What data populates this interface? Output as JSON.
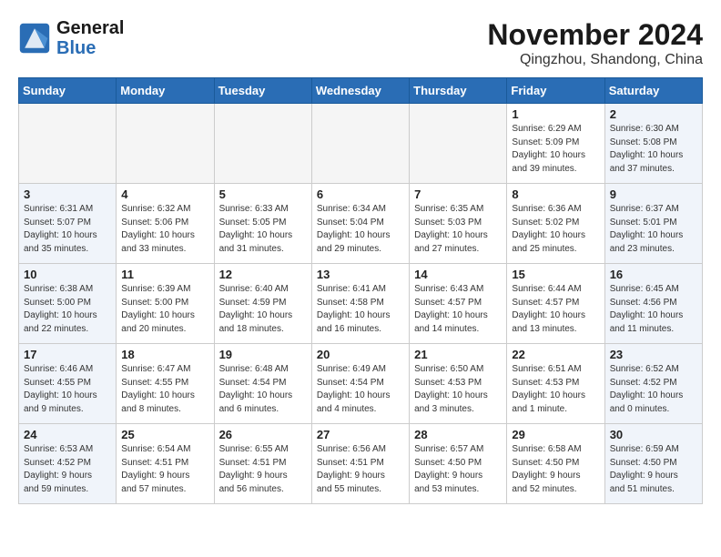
{
  "logo": {
    "line1": "General",
    "line2": "Blue"
  },
  "title": "November 2024",
  "location": "Qingzhou, Shandong, China",
  "weekdays": [
    "Sunday",
    "Monday",
    "Tuesday",
    "Wednesday",
    "Thursday",
    "Friday",
    "Saturday"
  ],
  "weeks": [
    [
      {
        "day": "",
        "info": "",
        "type": "empty"
      },
      {
        "day": "",
        "info": "",
        "type": "empty"
      },
      {
        "day": "",
        "info": "",
        "type": "empty"
      },
      {
        "day": "",
        "info": "",
        "type": "empty"
      },
      {
        "day": "",
        "info": "",
        "type": "empty"
      },
      {
        "day": "1",
        "info": "Sunrise: 6:29 AM\nSunset: 5:09 PM\nDaylight: 10 hours\nand 39 minutes.",
        "type": "weekend"
      },
      {
        "day": "2",
        "info": "Sunrise: 6:30 AM\nSunset: 5:08 PM\nDaylight: 10 hours\nand 37 minutes.",
        "type": "weekend"
      }
    ],
    [
      {
        "day": "3",
        "info": "Sunrise: 6:31 AM\nSunset: 5:07 PM\nDaylight: 10 hours\nand 35 minutes.",
        "type": "weekend"
      },
      {
        "day": "4",
        "info": "Sunrise: 6:32 AM\nSunset: 5:06 PM\nDaylight: 10 hours\nand 33 minutes.",
        "type": "normal"
      },
      {
        "day": "5",
        "info": "Sunrise: 6:33 AM\nSunset: 5:05 PM\nDaylight: 10 hours\nand 31 minutes.",
        "type": "normal"
      },
      {
        "day": "6",
        "info": "Sunrise: 6:34 AM\nSunset: 5:04 PM\nDaylight: 10 hours\nand 29 minutes.",
        "type": "normal"
      },
      {
        "day": "7",
        "info": "Sunrise: 6:35 AM\nSunset: 5:03 PM\nDaylight: 10 hours\nand 27 minutes.",
        "type": "normal"
      },
      {
        "day": "8",
        "info": "Sunrise: 6:36 AM\nSunset: 5:02 PM\nDaylight: 10 hours\nand 25 minutes.",
        "type": "weekend"
      },
      {
        "day": "9",
        "info": "Sunrise: 6:37 AM\nSunset: 5:01 PM\nDaylight: 10 hours\nand 23 minutes.",
        "type": "weekend"
      }
    ],
    [
      {
        "day": "10",
        "info": "Sunrise: 6:38 AM\nSunset: 5:00 PM\nDaylight: 10 hours\nand 22 minutes.",
        "type": "weekend"
      },
      {
        "day": "11",
        "info": "Sunrise: 6:39 AM\nSunset: 5:00 PM\nDaylight: 10 hours\nand 20 minutes.",
        "type": "normal"
      },
      {
        "day": "12",
        "info": "Sunrise: 6:40 AM\nSunset: 4:59 PM\nDaylight: 10 hours\nand 18 minutes.",
        "type": "normal"
      },
      {
        "day": "13",
        "info": "Sunrise: 6:41 AM\nSunset: 4:58 PM\nDaylight: 10 hours\nand 16 minutes.",
        "type": "normal"
      },
      {
        "day": "14",
        "info": "Sunrise: 6:43 AM\nSunset: 4:57 PM\nDaylight: 10 hours\nand 14 minutes.",
        "type": "normal"
      },
      {
        "day": "15",
        "info": "Sunrise: 6:44 AM\nSunset: 4:57 PM\nDaylight: 10 hours\nand 13 minutes.",
        "type": "weekend"
      },
      {
        "day": "16",
        "info": "Sunrise: 6:45 AM\nSunset: 4:56 PM\nDaylight: 10 hours\nand 11 minutes.",
        "type": "weekend"
      }
    ],
    [
      {
        "day": "17",
        "info": "Sunrise: 6:46 AM\nSunset: 4:55 PM\nDaylight: 10 hours\nand 9 minutes.",
        "type": "weekend"
      },
      {
        "day": "18",
        "info": "Sunrise: 6:47 AM\nSunset: 4:55 PM\nDaylight: 10 hours\nand 8 minutes.",
        "type": "normal"
      },
      {
        "day": "19",
        "info": "Sunrise: 6:48 AM\nSunset: 4:54 PM\nDaylight: 10 hours\nand 6 minutes.",
        "type": "normal"
      },
      {
        "day": "20",
        "info": "Sunrise: 6:49 AM\nSunset: 4:54 PM\nDaylight: 10 hours\nand 4 minutes.",
        "type": "normal"
      },
      {
        "day": "21",
        "info": "Sunrise: 6:50 AM\nSunset: 4:53 PM\nDaylight: 10 hours\nand 3 minutes.",
        "type": "normal"
      },
      {
        "day": "22",
        "info": "Sunrise: 6:51 AM\nSunset: 4:53 PM\nDaylight: 10 hours\nand 1 minute.",
        "type": "weekend"
      },
      {
        "day": "23",
        "info": "Sunrise: 6:52 AM\nSunset: 4:52 PM\nDaylight: 10 hours\nand 0 minutes.",
        "type": "weekend"
      }
    ],
    [
      {
        "day": "24",
        "info": "Sunrise: 6:53 AM\nSunset: 4:52 PM\nDaylight: 9 hours\nand 59 minutes.",
        "type": "weekend"
      },
      {
        "day": "25",
        "info": "Sunrise: 6:54 AM\nSunset: 4:51 PM\nDaylight: 9 hours\nand 57 minutes.",
        "type": "normal"
      },
      {
        "day": "26",
        "info": "Sunrise: 6:55 AM\nSunset: 4:51 PM\nDaylight: 9 hours\nand 56 minutes.",
        "type": "normal"
      },
      {
        "day": "27",
        "info": "Sunrise: 6:56 AM\nSunset: 4:51 PM\nDaylight: 9 hours\nand 55 minutes.",
        "type": "normal"
      },
      {
        "day": "28",
        "info": "Sunrise: 6:57 AM\nSunset: 4:50 PM\nDaylight: 9 hours\nand 53 minutes.",
        "type": "normal"
      },
      {
        "day": "29",
        "info": "Sunrise: 6:58 AM\nSunset: 4:50 PM\nDaylight: 9 hours\nand 52 minutes.",
        "type": "weekend"
      },
      {
        "day": "30",
        "info": "Sunrise: 6:59 AM\nSunset: 4:50 PM\nDaylight: 9 hours\nand 51 minutes.",
        "type": "weekend"
      }
    ]
  ]
}
